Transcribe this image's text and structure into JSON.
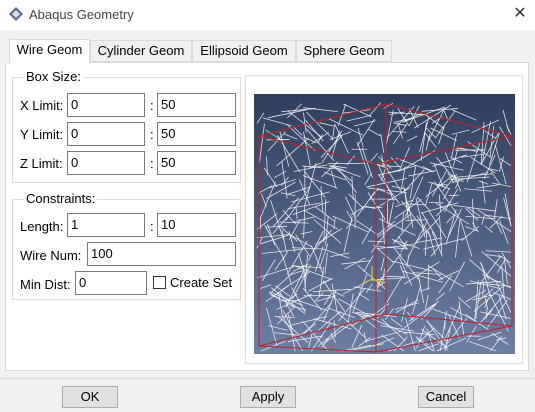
{
  "window": {
    "title": "Abaqus Geometry",
    "close_glyph": "✕"
  },
  "tabs": [
    {
      "label": "Wire Geom",
      "active": true
    },
    {
      "label": "Cylinder Geom",
      "active": false
    },
    {
      "label": "Ellipsoid Geom",
      "active": false
    },
    {
      "label": "Sphere Geom",
      "active": false
    }
  ],
  "box_size": {
    "title": "Box Size:",
    "separator": ":",
    "rows": [
      {
        "label": "X Limit:",
        "min": "0",
        "max": "50"
      },
      {
        "label": "Y Limit:",
        "min": "0",
        "max": "50"
      },
      {
        "label": "Z Limit:",
        "min": "0",
        "max": "50"
      }
    ]
  },
  "constraints": {
    "title": "Constraints:",
    "length_label": "Length:",
    "length_min": "1",
    "length_max": "10",
    "separator": ":",
    "wire_num_label": "Wire Num:",
    "wire_num": "100",
    "min_dist_label": "Min Dist:",
    "min_dist": "0",
    "create_set_label": "Create Set",
    "create_set_checked": false
  },
  "preview": {
    "background_top": "#2d3f5c",
    "background_bottom": "#6d7fa2",
    "box_color": "#c0202a",
    "wire_color": "#ffffff",
    "axis_icon": "xyz-triad-icon"
  },
  "buttons": {
    "ok": "OK",
    "apply": "Apply",
    "cancel": "Cancel"
  }
}
